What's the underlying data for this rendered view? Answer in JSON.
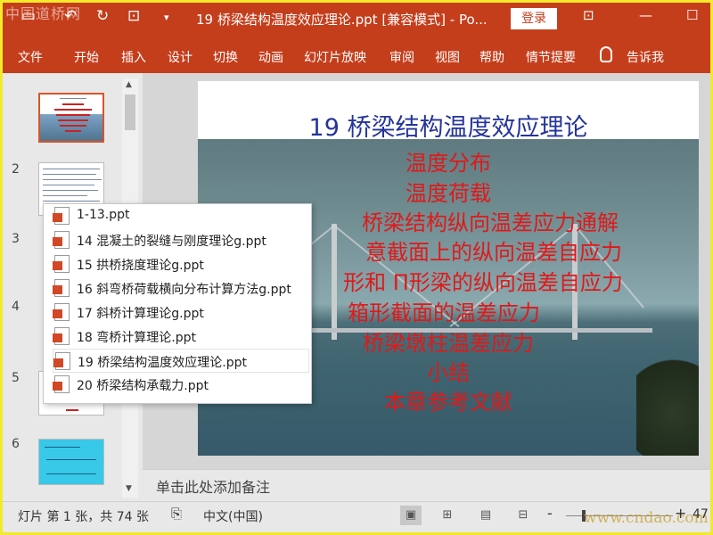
{
  "titlebar": {
    "watermark": "中国道桥网",
    "doc_title": "19  桥梁结构温度效应理论.ppt [兼容模式]  -  Po...",
    "login": "登录",
    "icons": [
      "save-icon",
      "undo-icon",
      "redo-icon",
      "present-icon",
      "customize-icon",
      "restore-icon",
      "maximize-icon"
    ]
  },
  "ribbon": {
    "tabs": [
      "文件",
      "开始",
      "插入",
      "设计",
      "切换",
      "动画",
      "幻灯片放映",
      "审阅",
      "视图",
      "帮助",
      "情节提要"
    ],
    "tell_me": "告诉我"
  },
  "thumbnails": {
    "numbers": [
      "2",
      "3",
      "4",
      "5",
      "6"
    ]
  },
  "slide": {
    "title": "19  桥梁结构温度效应理论",
    "items": [
      "温度分布",
      "温度荷载",
      "桥梁结构纵向温差应力通解",
      "意截面上的纵向温差自应力",
      "形和 Π形梁的纵向温差自应力",
      "箱形截面的温差应力",
      "桥梁墩柱温差应力",
      "小结",
      "本章参考文献"
    ]
  },
  "notes": {
    "placeholder": "单击此处添加备注"
  },
  "status": {
    "slide_info": "灯片 第 1 张，共 74 张",
    "language": "中文(中国)",
    "zoom_minus": "-",
    "zoom_plus": "+",
    "zoom_partial": "47",
    "watermark": "www.cndao.com"
  },
  "popup": {
    "items": [
      "1-13.ppt",
      "14  混凝土的裂缝与刚度理论g.ppt",
      "15  拱桥挠度理论g.ppt",
      "16 斜弯桥荷载横向分布计算方法g.ppt",
      "17  斜桥计算理论g.ppt",
      "18  弯桥计算理论.ppt",
      "19  桥梁结构温度效应理论.ppt",
      "20 桥梁结构承载力.ppt"
    ],
    "current_index": 6
  },
  "colors": {
    "accent": "#c43e1c",
    "slide_title": "#24349a",
    "slide_text": "#e01919"
  }
}
